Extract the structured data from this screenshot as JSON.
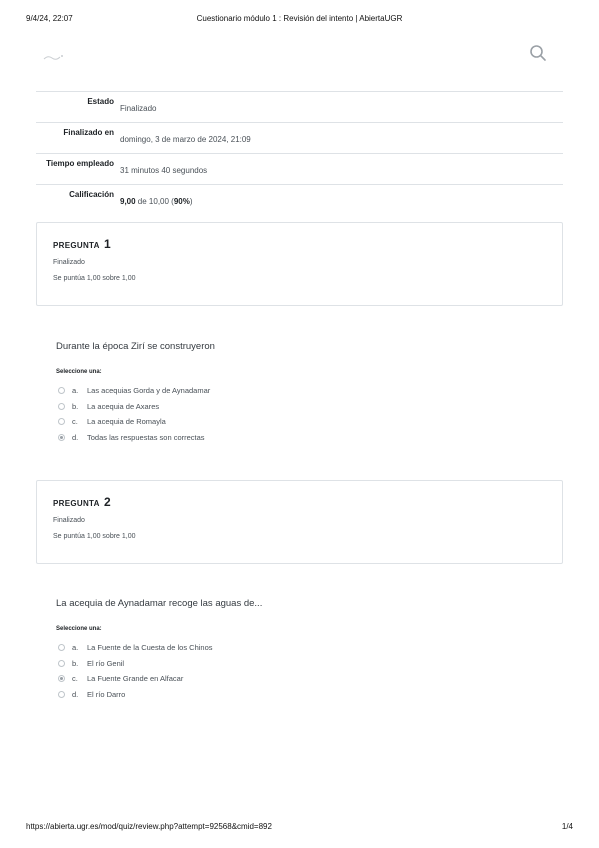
{
  "print_header": {
    "date": "9/4/24, 22:07",
    "title": "Cuestionario módulo 1 : Revisión del intento | AbiertaUGR"
  },
  "summary": {
    "rows": [
      {
        "label": "Estado",
        "value": "Finalizado"
      },
      {
        "label": "Finalizado en",
        "value": "domingo, 3 de marzo de 2024, 21:09"
      },
      {
        "label": "Tiempo empleado",
        "value": "31 minutos 40 segundos"
      },
      {
        "label": "Calificación",
        "value_bold": "9,00",
        "value_rest": " de 10,00 (",
        "value_pct": "90%",
        "value_end": ")"
      }
    ]
  },
  "questions": [
    {
      "label": "PREGUNTA",
      "number": "1",
      "state": "Finalizado",
      "grade": "Se puntúa 1,00 sobre 1,00",
      "text": "Durante la época Zirí se construyeron",
      "prompt": "Seleccione una:",
      "answers": [
        {
          "letter": "a.",
          "text": "Las acequias Gorda y de Aynadamar",
          "checked": false
        },
        {
          "letter": "b.",
          "text": "La acequia de Axares",
          "checked": false
        },
        {
          "letter": "c.",
          "text": "La acequia de Romayla",
          "checked": false
        },
        {
          "letter": "d.",
          "text": "Todas las respuestas son correctas",
          "checked": true
        }
      ]
    },
    {
      "label": "PREGUNTA",
      "number": "2",
      "state": "Finalizado",
      "grade": "Se puntúa 1,00 sobre 1,00",
      "text": "La acequia de Aynadamar recoge las aguas de...",
      "prompt": "Seleccione una:",
      "answers": [
        {
          "letter": "a.",
          "text": "La Fuente de la Cuesta de los Chinos",
          "checked": false
        },
        {
          "letter": "b.",
          "text": "El río Genil",
          "checked": false
        },
        {
          "letter": "c.",
          "text": "La Fuente Grande en Alfacar",
          "checked": true
        },
        {
          "letter": "d.",
          "text": "El río Darro",
          "checked": false
        }
      ]
    }
  ],
  "print_footer": {
    "url": "https://abierta.ugr.es/mod/quiz/review.php?attempt=92568&cmid=892",
    "page": "1/4"
  }
}
